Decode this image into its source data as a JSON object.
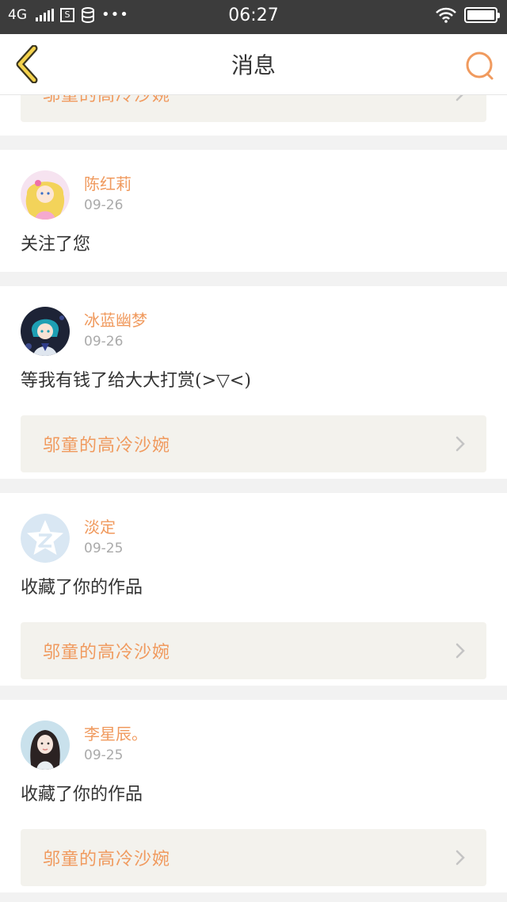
{
  "status_bar": {
    "network": "4G",
    "time": "06:27",
    "sim_label": "S",
    "more": "•••",
    "battery_level": 1.0
  },
  "header": {
    "title": "消息"
  },
  "colors": {
    "accent": "#f09a5e",
    "back_icon": "#c9a82a",
    "work_bg": "#f3f2ed"
  },
  "partial_work_title": "邬童的高冷沙婉",
  "messages": [
    {
      "username": "陈红莉",
      "date": "09-26",
      "text": "关注了您",
      "work": null,
      "avatar": "anime-girl-avatar"
    },
    {
      "username": "冰蓝幽梦",
      "date": "09-26",
      "text": "等我有钱了给大大打赏(>▽<)",
      "work": "邬童的高冷沙婉",
      "avatar": "anime-boy-avatar"
    },
    {
      "username": "淡定",
      "date": "09-25",
      "text": "收藏了你的作品",
      "work": "邬童的高冷沙婉",
      "avatar": "default-qzone-avatar"
    },
    {
      "username": "李星辰。",
      "date": "09-25",
      "text": "收藏了你的作品",
      "work": "邬童的高冷沙婉",
      "avatar": "photo-girl-avatar"
    }
  ]
}
